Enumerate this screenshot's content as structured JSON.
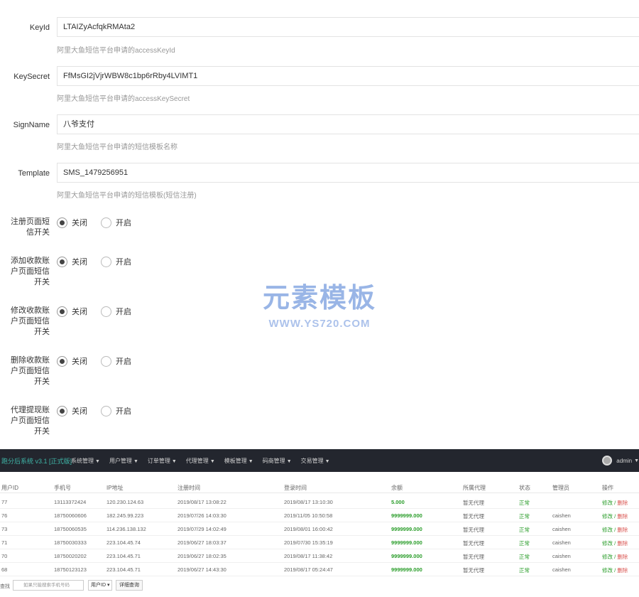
{
  "form": {
    "fields": [
      {
        "label": "KeyId",
        "value": "LTAIZyAcfqkRMAta2",
        "help": "阿里大鱼短信平台申请的accessKeyId"
      },
      {
        "label": "KeySecret",
        "value": "FfMsGI2jVjrWBW8c1bp6rRby4LVIMT1",
        "help": "阿里大鱼短信平台申请的accessKeySecret"
      },
      {
        "label": "SignName",
        "value": "八爷支付",
        "help": "阿里大鱼短信平台申请的短信模板名称"
      },
      {
        "label": "Template",
        "value": "SMS_1479256951",
        "help": "阿里大鱼短信平台申请的短信模板(短信注册)"
      }
    ],
    "toggles": [
      {
        "label_lines": [
          "注册页面短",
          "信开关"
        ],
        "off": "关闭",
        "on": "开启",
        "selected": "off"
      },
      {
        "label_lines": [
          "添加收款账",
          "户页面短信",
          "开关"
        ],
        "off": "关闭",
        "on": "开启",
        "selected": "off"
      },
      {
        "label_lines": [
          "修改收款账",
          "户页面短信",
          "开关"
        ],
        "off": "关闭",
        "on": "开启",
        "selected": "off"
      },
      {
        "label_lines": [
          "删除收款账",
          "户页面短信",
          "开关"
        ],
        "off": "关闭",
        "on": "开启",
        "selected": "off"
      },
      {
        "label_lines": [
          "代理提现账",
          "户页面短信",
          "开关"
        ],
        "off": "关闭",
        "on": "开启",
        "selected": "off"
      }
    ]
  },
  "watermark": {
    "main": "元素模板",
    "sub": "WWW.YS720.COM"
  },
  "admin": {
    "brand": "跑分后系统 v3.1 [正式版]",
    "menu": [
      "系统管理",
      "用户管理",
      "订单管理",
      "代理管理",
      "模板管理",
      "码商管理",
      "交易管理"
    ],
    "user": "admin",
    "columns": [
      "用户ID",
      "手机号",
      "IP地址",
      "注册时间",
      "登录时间",
      "余额",
      "所属代理",
      "状态",
      "管理员",
      "操作"
    ],
    "rows": [
      [
        "77",
        "13113372424",
        "120.230.124.63",
        "2019/08/17 13:08:22",
        "2019/08/17 13:10:30",
        "5.000",
        "暂无代理",
        "正常",
        "",
        "修改",
        "删除"
      ],
      [
        "76",
        "18750060606",
        "182.245.99.223",
        "2019/07/26 14:03:30",
        "2019/11/05 10:50:58",
        "9999999.000",
        "暂无代理",
        "正常",
        "caishen",
        "修改",
        "删除"
      ],
      [
        "73",
        "18750060535",
        "114.236.138.132",
        "2019/07/29 14:02:49",
        "2019/08/01 16:00:42",
        "9999999.000",
        "暂无代理",
        "正常",
        "caishen",
        "修改",
        "删除"
      ],
      [
        "71",
        "18750030333",
        "223.104.45.74",
        "2019/06/27 18:03:37",
        "2019/07/30 15:35:19",
        "9999999.000",
        "暂无代理",
        "正常",
        "caishen",
        "修改",
        "删除"
      ],
      [
        "70",
        "18750020202",
        "223.104.45.71",
        "2019/06/27 18:02:35",
        "2019/08/17 11:38:42",
        "9999999.000",
        "暂无代理",
        "正常",
        "caishen",
        "修改",
        "删除"
      ],
      [
        "68",
        "18750123123",
        "223.104.45.71",
        "2019/06/27 14:43:30",
        "2019/08/17 05:24:47",
        "9999999.000",
        "暂无代理",
        "正常",
        "caishen",
        "修改",
        "删除"
      ]
    ],
    "search": {
      "label": "查找",
      "placeholder": "如果只能搜索手机号码",
      "select": "用户ID",
      "button": "详细查询"
    }
  }
}
